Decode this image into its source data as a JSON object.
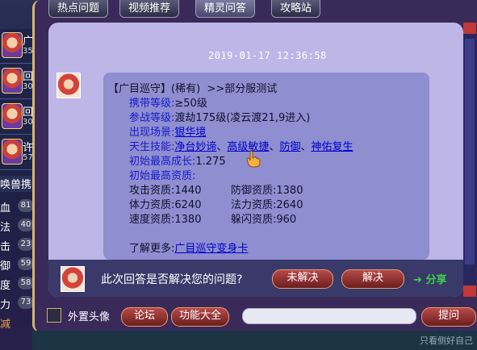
{
  "tabs": [
    {
      "label": "热点问题"
    },
    {
      "label": "视频推荐"
    },
    {
      "label": "精灵问答",
      "active": true
    },
    {
      "label": "攻略站"
    }
  ],
  "sidebar": {
    "slots": [
      {
        "char": "广",
        "num": "35"
      },
      {
        "char": "回",
        "num": "30"
      },
      {
        "char": "回",
        "num": "30"
      },
      {
        "char": "许",
        "num": "57"
      }
    ],
    "label": "唤兽携",
    "stats": [
      {
        "char": "血",
        "num": "81"
      },
      {
        "char": "法",
        "num": "40"
      },
      {
        "char": "击",
        "num": "23"
      },
      {
        "char": "御",
        "num": "59"
      },
      {
        "char": "度",
        "num": "58"
      },
      {
        "char": "力",
        "num": "73"
      },
      {
        "char": "减",
        "num": ""
      }
    ]
  },
  "chat": {
    "timestamp": "2019-01-17 12:36:58",
    "header": {
      "name": "【广目巡守】",
      "rarity": "(稀有)",
      "note": ">>部分服测试"
    },
    "lines": [
      {
        "label": "携带等级:",
        "value": "≥50级"
      },
      {
        "label": "参战等级:",
        "value": "渡劫175级(凌云渡21,9进入)"
      },
      {
        "label": "出现场景:",
        "value": "银华境"
      },
      {
        "label": "天生技能:",
        "links": [
          "净台妙谛",
          "高级敏捷",
          "防御",
          "神佑复生"
        ]
      },
      {
        "label": "初始最高成长:",
        "value": "1.275"
      },
      {
        "label": "初始最高资质:"
      }
    ],
    "stats": [
      {
        "name": "攻击资质:",
        "value": "1440"
      },
      {
        "name": "防御资质:",
        "value": "1380"
      },
      {
        "name": "体力资质:",
        "value": "6240"
      },
      {
        "name": "法力资质:",
        "value": "2640"
      },
      {
        "name": "速度资质:",
        "value": "1380"
      },
      {
        "name": "躲闪资质:",
        "value": "960"
      }
    ],
    "more_label": "了解更多:",
    "more_link": "广目巡守变身卡"
  },
  "feedback": {
    "question": "此次回答是否解决您的问题?",
    "unresolved": "未解决",
    "resolved": "解决",
    "share": "分享"
  },
  "toolbar": {
    "external_avatar": "外置头像",
    "forum": "论坛",
    "features": "功能大全",
    "ask": "提问"
  },
  "bottom": {
    "text": "只看侧好自己"
  },
  "colors": {
    "panel_bg": "#bdb6e6",
    "bubble_bg": "#8e8ed0",
    "label_blue": "#1a1acc",
    "link_blue": "#0000cc",
    "share_green": "#3ad04a",
    "button_red": "#8a2a2a"
  }
}
